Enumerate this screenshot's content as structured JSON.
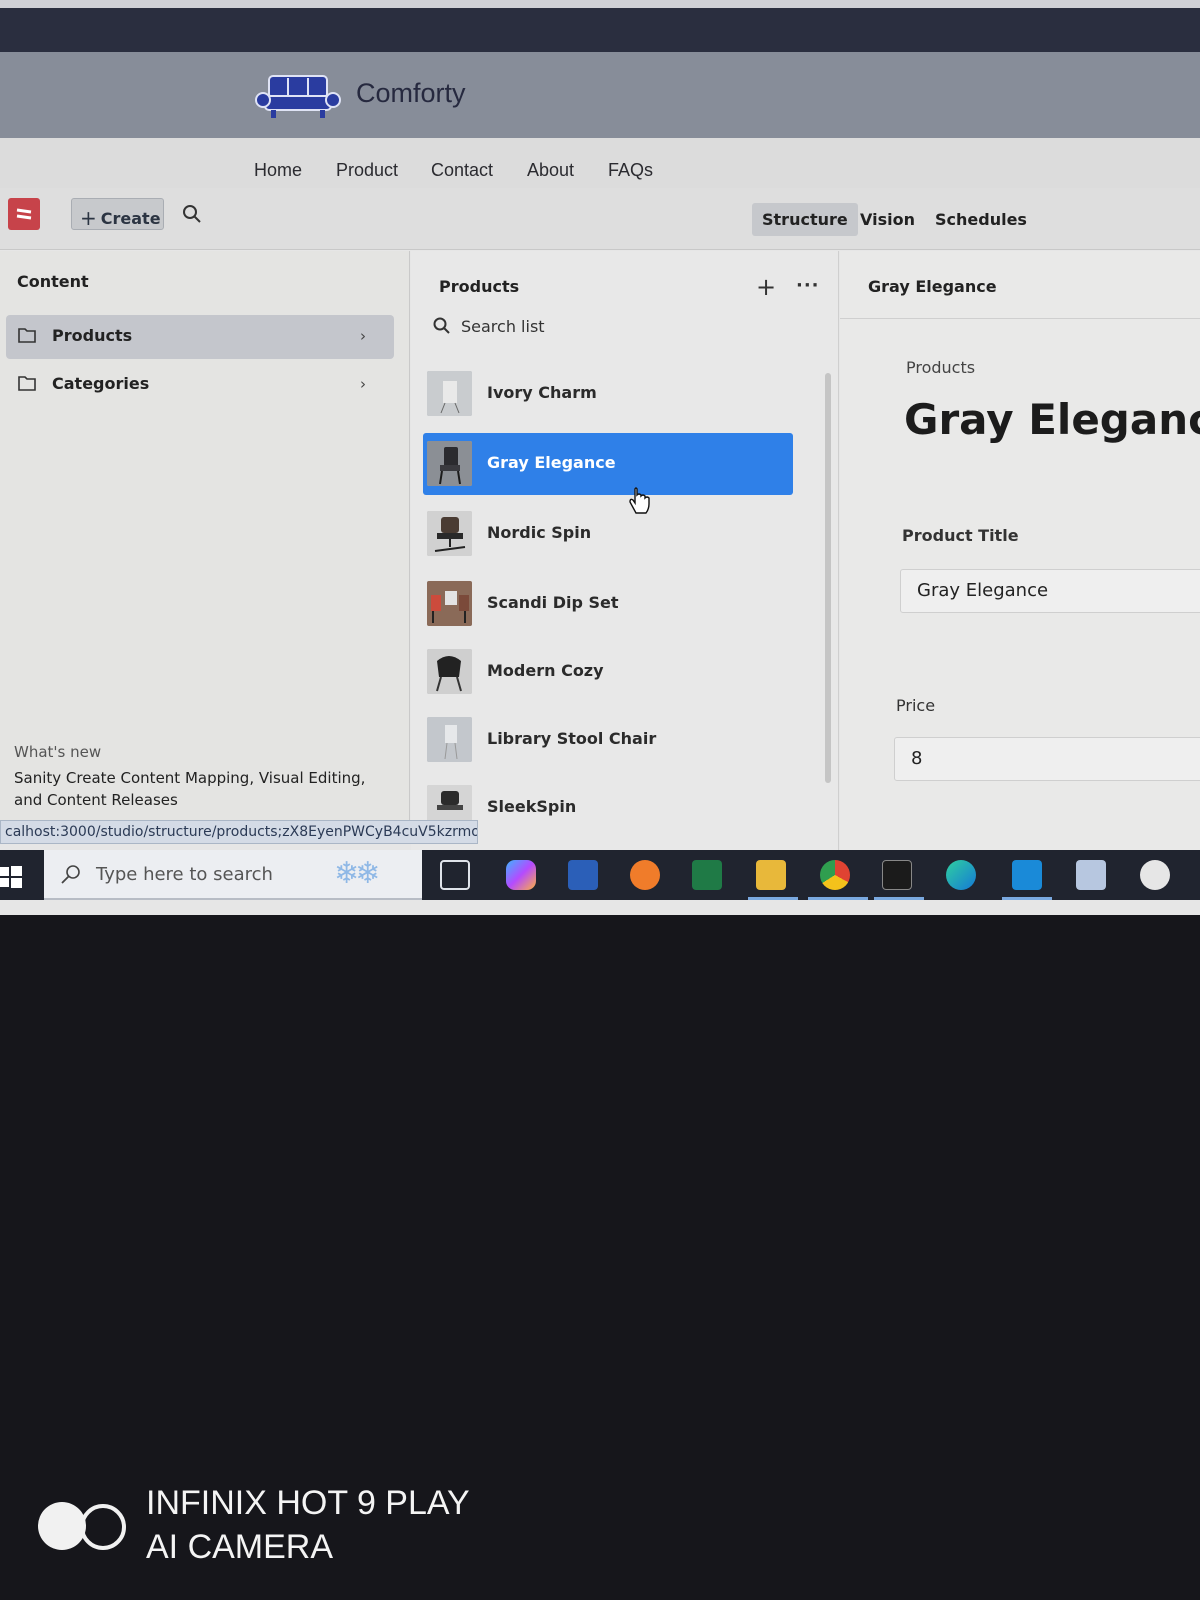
{
  "site": {
    "brand": "Comforty",
    "nav": [
      "Home",
      "Product",
      "Contact",
      "About",
      "FAQs"
    ]
  },
  "studio": {
    "create_label": "Create",
    "tabs": [
      "Structure",
      "Vision",
      "Schedules"
    ],
    "active_tab": "Structure"
  },
  "content_pane": {
    "title": "Content",
    "items": [
      {
        "label": "Products",
        "icon": "folder-icon",
        "selected": true
      },
      {
        "label": "Categories",
        "icon": "folder-icon",
        "selected": false
      }
    ],
    "whats_new_label": "What's new",
    "whats_new_text": "Sanity Create Content Mapping, Visual Editing, and Content Releases"
  },
  "products_pane": {
    "title": "Products",
    "search_placeholder": "Search list",
    "items": [
      {
        "name": "Ivory Charm",
        "selected": false
      },
      {
        "name": "Gray Elegance",
        "selected": true
      },
      {
        "name": "Nordic Spin",
        "selected": false
      },
      {
        "name": "Scandi Dip Set",
        "selected": false
      },
      {
        "name": "Modern Cozy",
        "selected": false
      },
      {
        "name": "Library Stool Chair",
        "selected": false
      },
      {
        "name": "SleekSpin",
        "selected": false
      }
    ]
  },
  "document_pane": {
    "header": "Gray Elegance",
    "doc_type": "Products",
    "doc_title": "Gray Elegance",
    "fields": [
      {
        "label": "Product Title",
        "value": "Gray Elegance"
      },
      {
        "label": "Price",
        "value": "8"
      }
    ]
  },
  "status_url": "calhost:3000/studio/structure/products;zX8EyenPWCyB4cuV5kzrmo",
  "taskbar": {
    "search_placeholder": "Type here to search",
    "apps": [
      "task-view-icon",
      "copilot-icon",
      "word-icon",
      "firefox-icon",
      "excel-icon",
      "file-explorer-icon",
      "chrome-icon",
      "terminal-icon",
      "edge-icon",
      "vscode-icon",
      "notepad-icon",
      "paint-icon"
    ]
  },
  "camera_watermark": {
    "line1": "INFINIX HOT 9 PLAY",
    "line2": "AI CAMERA"
  },
  "colors": {
    "selection_blue": "#2f80e8",
    "header_gray": "#878d99",
    "brand_navy": "#26293f",
    "sanity_red": "#c7434a"
  }
}
